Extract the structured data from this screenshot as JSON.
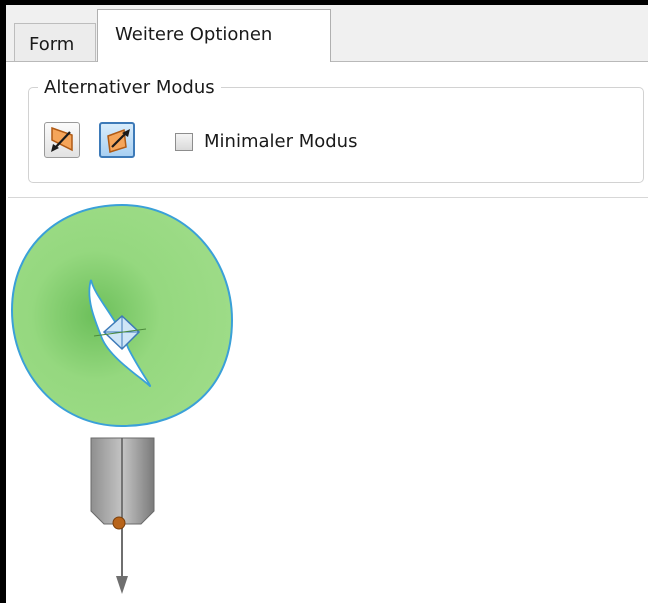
{
  "tabs": [
    {
      "label": "Form",
      "active": false
    },
    {
      "label": "Weitere Optionen",
      "active": true
    }
  ],
  "group": {
    "legend": "Alternativer Modus",
    "mode_buttons": [
      {
        "name": "mode-1",
        "icon": "reverse-direction-icon",
        "selected": false
      },
      {
        "name": "mode-2",
        "icon": "forward-direction-icon",
        "selected": true
      }
    ],
    "checkbox": {
      "label": "Minimaler Modus",
      "checked": false
    }
  },
  "viewport": {
    "ring_color": "#95d87f",
    "ring_edge_color": "#3aa0d8",
    "shaft_color": "#a9a9a9",
    "point_color": "#b8641a"
  }
}
